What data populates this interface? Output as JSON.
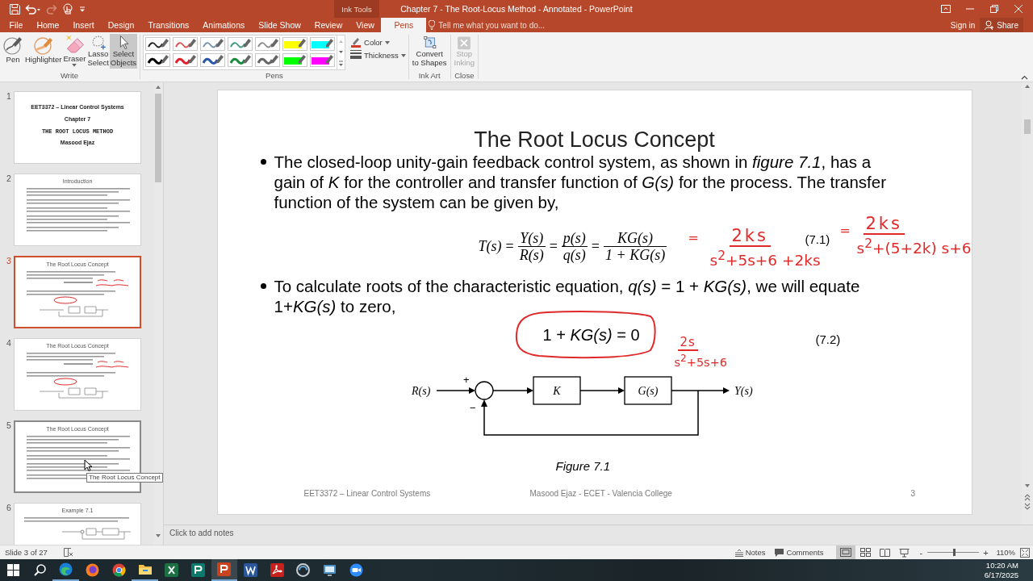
{
  "window": {
    "title": "Chapter 7 - The Root-Locus Method - Annotated - PowerPoint",
    "context_label": "Ink Tools",
    "sign_in": "Sign in",
    "share": "Share"
  },
  "quick_access": [
    {
      "kind": "save",
      "disabled": false
    },
    {
      "kind": "undo",
      "disabled": false
    },
    {
      "kind": "redo",
      "disabled": true
    },
    {
      "kind": "touch",
      "disabled": false
    },
    {
      "kind": "customize",
      "disabled": false
    }
  ],
  "tabs": [
    {
      "label": "File",
      "selected": false
    },
    {
      "label": "Home",
      "selected": false
    },
    {
      "label": "Insert",
      "selected": false
    },
    {
      "label": "Design",
      "selected": false
    },
    {
      "label": "Transitions",
      "selected": false
    },
    {
      "label": "Animations",
      "selected": false
    },
    {
      "label": "Slide Show",
      "selected": false
    },
    {
      "label": "Review",
      "selected": false
    },
    {
      "label": "View",
      "selected": false
    },
    {
      "label": "Pens",
      "selected": true
    }
  ],
  "tell_me": {
    "placeholder": "Tell me what you want to do..."
  },
  "ribbon": {
    "write": {
      "label": "Write",
      "tools": [
        {
          "kind": "pen",
          "lines": [
            "Pen"
          ],
          "selected": false,
          "dropdown": false
        },
        {
          "kind": "highlighter",
          "lines": [
            "Highlighter"
          ],
          "selected": false,
          "dropdown": false
        },
        {
          "kind": "eraser",
          "lines": [
            "Eraser"
          ],
          "selected": false,
          "dropdown": true
        },
        {
          "kind": "lasso",
          "lines": [
            "Lasso",
            "Select"
          ],
          "selected": false,
          "dropdown": false
        },
        {
          "kind": "pointer",
          "lines": [
            "Select",
            "Objects"
          ],
          "selected": true,
          "dropdown": false
        }
      ]
    },
    "pens": {
      "label": "Pens",
      "items": [
        {
          "kind": "thin",
          "color": "#222222"
        },
        {
          "kind": "thin",
          "color": "#d9534f"
        },
        {
          "kind": "thin",
          "color": "#6f8fb3"
        },
        {
          "kind": "thin",
          "color": "#3f9a7c"
        },
        {
          "kind": "thin",
          "color": "#8c8c8c"
        },
        {
          "kind": "highlighter",
          "color": "#ffff00"
        },
        {
          "kind": "highlighter",
          "color": "#00ffff"
        },
        {
          "kind": "thick",
          "color": "#000000"
        },
        {
          "kind": "thick",
          "color": "#e0202a"
        },
        {
          "kind": "thick",
          "color": "#2a56a8"
        },
        {
          "kind": "thick",
          "color": "#1a8a3e"
        },
        {
          "kind": "thick",
          "color": "#666666"
        },
        {
          "kind": "highlighter",
          "color": "#00ff00"
        },
        {
          "kind": "highlighter",
          "color": "#ff00ff"
        }
      ],
      "color_button": "Color",
      "thickness_button": "Thickness"
    },
    "ink_art": {
      "label": "Ink Art",
      "button": {
        "lines": [
          "Convert",
          "to Shapes"
        ],
        "disabled": false
      }
    },
    "close": {
      "label": "Close",
      "button": {
        "lines": [
          "Stop",
          "Inking"
        ],
        "disabled": true
      }
    }
  },
  "slides_panel": {
    "thumbnails": [
      {
        "number": "1",
        "selected": false,
        "hovered": false,
        "kind": "title",
        "lines": [
          "EET3372 – Linear Control Systems",
          "Chapter 7",
          "THE ROOT LOCUS METHOD",
          "Masood Ejaz"
        ]
      },
      {
        "number": "2",
        "selected": false,
        "hovered": false,
        "kind": "bullets",
        "title": "Introduction"
      },
      {
        "number": "3",
        "selected": true,
        "hovered": false,
        "kind": "annotated",
        "title": "The Root Locus Concept"
      },
      {
        "number": "4",
        "selected": false,
        "hovered": false,
        "kind": "annotated",
        "title": "The Root Locus Concept"
      },
      {
        "number": "5",
        "selected": false,
        "hovered": true,
        "kind": "bullets",
        "title": "The Root Locus Concept"
      },
      {
        "number": "6",
        "selected": false,
        "hovered": false,
        "kind": "diagram",
        "title": "Example 7.1"
      }
    ],
    "tooltip": "The Root Locus Concept"
  },
  "slide": {
    "title": "The Root Locus Concept",
    "bullets": [
      "The closed-loop unity-gain feedback control system, as shown in *figure 7.1*, has a gain of *K* for the controller and transfer function of *G(s)* for the process. The transfer function of the system can be given by,",
      "To calculate roots of the characteristic equation, *q(s)* = 1 + *KG(s)*, we will equate 1+*KG(s)* to zero,"
    ],
    "equation": {
      "terms": [
        {
          "kind": "text",
          "text": "T(s)"
        },
        {
          "kind": "operator",
          "text": "="
        },
        {
          "kind": "fraction",
          "numerator": "Y(s)",
          "denominator": "R(s)"
        },
        {
          "kind": "operator",
          "text": "="
        },
        {
          "kind": "fraction",
          "numerator": "p(s)",
          "denominator": "q(s)"
        },
        {
          "kind": "operator",
          "text": "="
        },
        {
          "kind": "fraction",
          "numerator": "KG(s)",
          "denominator": "1 + KG(s)"
        }
      ],
      "number": "(7.1)"
    },
    "boxed_equation": {
      "text": "1 + *KG(s)* = 0",
      "number": "(7.2)"
    },
    "ink": [
      {
        "kind": "equals",
        "text": "="
      },
      {
        "kind": "fraction",
        "numerator": "2ks",
        "denominator": "s$^{2}$+5s+6 +2ks"
      },
      {
        "kind": "equals",
        "text": "="
      },
      {
        "kind": "fraction",
        "numerator": "2ks",
        "denominator": "s$^{2}$+(5+2k) s+6"
      },
      {
        "kind": "ellipse"
      },
      {
        "kind": "fraction",
        "numerator": "2s",
        "denominator": "s$^{2}$+5s+6"
      }
    ],
    "diagram": {
      "input": "R(s)",
      "plus": "+",
      "minus": "−",
      "blocks": [
        "K",
        "G(s)"
      ],
      "output": "Y(s)"
    },
    "caption": "Figure 7.1",
    "footer": {
      "left": "EET3372 – Linear Control Systems",
      "center": "Masood Ejaz - ECET - Valencia College",
      "page": "3"
    }
  },
  "notes": {
    "placeholder": "Click to add notes"
  },
  "status_bar": {
    "slide_info": "Slide 3 of 27",
    "notes": "Notes",
    "comments": "Comments",
    "views": [
      {
        "kind": "normal",
        "selected": true
      },
      {
        "kind": "sorter",
        "selected": false
      },
      {
        "kind": "reading",
        "selected": false
      },
      {
        "kind": "slideshow",
        "selected": false
      }
    ],
    "zoom_out": "-",
    "zoom_in": "+",
    "zoom": {
      "level": 0.52
    },
    "zoom_percent": "110%"
  },
  "taskbar": {
    "apps": [
      {
        "kind": "edge",
        "running": true,
        "selected": false
      },
      {
        "kind": "firefox",
        "running": false,
        "selected": false
      },
      {
        "kind": "chrome",
        "running": false,
        "selected": false
      },
      {
        "kind": "explorer",
        "running": true,
        "selected": false
      },
      {
        "kind": "excel",
        "running": false,
        "selected": false
      },
      {
        "kind": "publisher",
        "running": false,
        "selected": false
      },
      {
        "kind": "powerpoint",
        "running": true,
        "selected": true
      },
      {
        "kind": "word",
        "running": false,
        "selected": false
      },
      {
        "kind": "acrobat",
        "running": false,
        "selected": false
      },
      {
        "kind": "tool",
        "running": false,
        "selected": false
      },
      {
        "kind": "remote",
        "running": false,
        "selected": false
      },
      {
        "kind": "zoom",
        "running": false,
        "selected": false
      }
    ],
    "time": "10:20 AM",
    "date": "6/17/2025"
  }
}
